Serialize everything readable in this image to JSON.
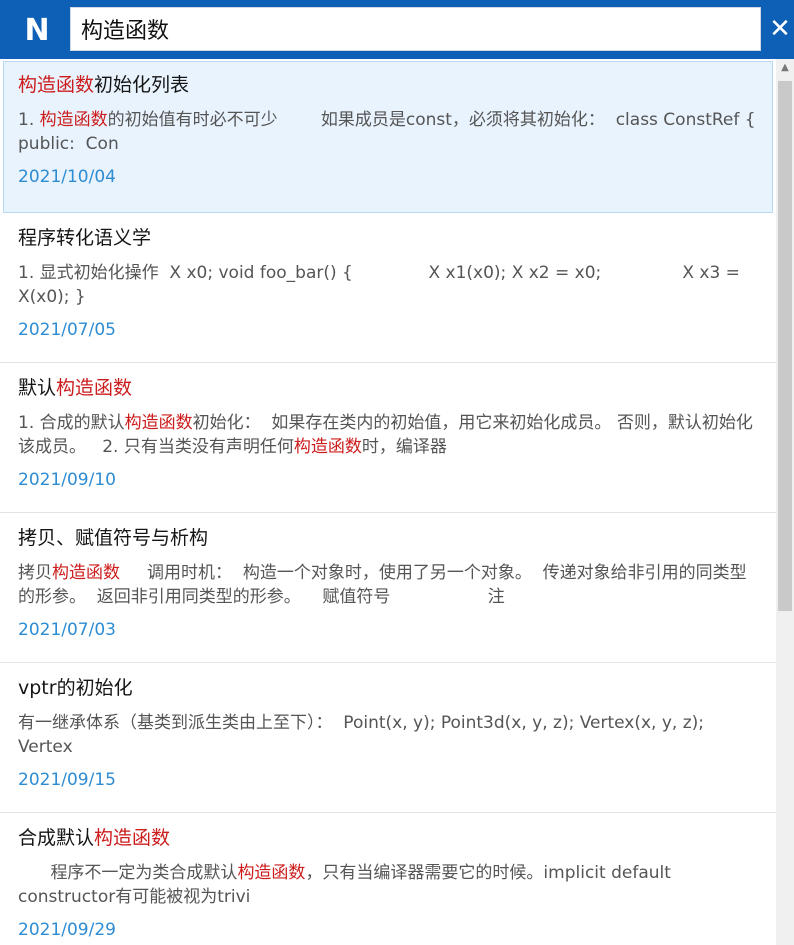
{
  "app": {
    "logo_letter": "N"
  },
  "search": {
    "query": "构造函数",
    "close_label": "✕"
  },
  "scrollbar": {
    "up_arrow": "▲"
  },
  "results": [
    {
      "title": [
        {
          "text": "构造函数",
          "hl": true
        },
        {
          "text": "初始化列表",
          "hl": false
        }
      ],
      "snippet": [
        {
          "text": "1. ",
          "hl": false
        },
        {
          "text": "构造函数",
          "hl": true
        },
        {
          "text": "的初始值有时必不可少        如果成员是const，必须将其初始化：  class ConstRef { public:  Con",
          "hl": false
        }
      ],
      "date": "2021/10/04",
      "selected": true
    },
    {
      "title": [
        {
          "text": "程序转化语义学",
          "hl": false
        }
      ],
      "snippet": [
        {
          "text": "1. 显式初始化操作  X x0; void foo_bar() {              X x1(x0); X x2 = x0;               X x3 = X(x0); }",
          "hl": false
        }
      ],
      "date": "2021/07/05",
      "selected": false
    },
    {
      "title": [
        {
          "text": "默认",
          "hl": false
        },
        {
          "text": "构造函数",
          "hl": true
        }
      ],
      "snippet": [
        {
          "text": "1. 合成的默认",
          "hl": false
        },
        {
          "text": "构造函数",
          "hl": true
        },
        {
          "text": "初始化：  如果存在类内的初始值，用它来初始化成员。 否则，默认初始化该成员。   2. 只有当类没有声明任何",
          "hl": false
        },
        {
          "text": "构造函数",
          "hl": true
        },
        {
          "text": "时，编译器",
          "hl": false
        }
      ],
      "date": "2021/09/10",
      "selected": false
    },
    {
      "title": [
        {
          "text": "拷贝、赋值符号与析构",
          "hl": false
        }
      ],
      "snippet": [
        {
          "text": "拷贝",
          "hl": false
        },
        {
          "text": "构造函数",
          "hl": true
        },
        {
          "text": "     调用时机：  构造一个对象时，使用了另一个对象。  传递对象给非引用的同类型的形参。  返回非引用同类型的形参。    赋值符号                  注",
          "hl": false
        }
      ],
      "date": "2021/07/03",
      "selected": false
    },
    {
      "title": [
        {
          "text": "vptr的初始化",
          "hl": false
        }
      ],
      "snippet": [
        {
          "text": "有一继承体系（基类到派生类由上至下）：  Point(x, y); Point3d(x, y, z); Vertex(x, y, z); Vertex",
          "hl": false
        }
      ],
      "date": "2021/09/15",
      "selected": false
    },
    {
      "title": [
        {
          "text": "合成默认",
          "hl": false
        },
        {
          "text": "构造函数",
          "hl": true
        }
      ],
      "snippet": [
        {
          "text": "      程序不一定为类合成默认",
          "hl": false
        },
        {
          "text": "构造函数",
          "hl": true
        },
        {
          "text": "，只有当编译器需要它的时候。implicit default constructor有可能被视为trivi",
          "hl": false
        }
      ],
      "date": "2021/09/29",
      "selected": false
    }
  ],
  "colors": {
    "topbar": "#0e5fb6",
    "highlight": "#cc1c1c",
    "date": "#2e8cd3",
    "selected_bg": "#e8f3fd"
  }
}
